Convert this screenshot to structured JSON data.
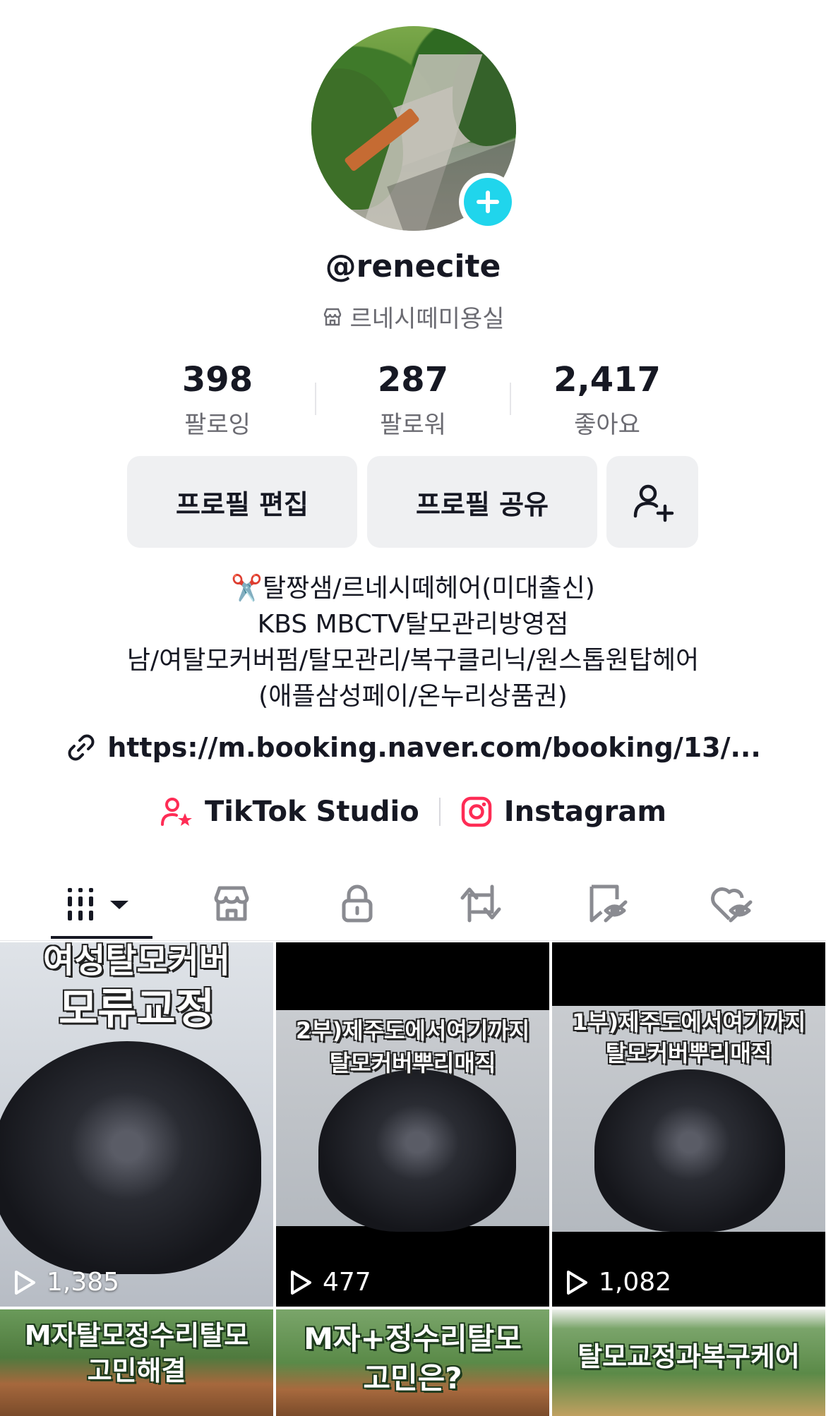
{
  "profile": {
    "username": "@renecite",
    "business_name": "르네시떼미용실",
    "business_icon": "store-icon"
  },
  "stats": [
    {
      "value": "398",
      "label": "팔로잉"
    },
    {
      "value": "287",
      "label": "팔로워"
    },
    {
      "value": "2,417",
      "label": "좋아요"
    }
  ],
  "actions": {
    "edit_profile": "프로필 편집",
    "share_profile": "프로필 공유",
    "add_friend_icon": "add-user-icon"
  },
  "bio": {
    "line1": "✂️탈짱샘/르네시떼헤어(미대출신)",
    "line2": "KBS MBCTV탈모관리방영점",
    "line3": "남/여탈모커버펌/탈모관리/복구클리닉/원스톱원탑헤어",
    "line4": "(애플삼성페이/온누리상품권)"
  },
  "link": {
    "url": "https://m.booking.naver.com/booking/13/..."
  },
  "external_links": {
    "studio": "TikTok Studio",
    "instagram": "Instagram"
  },
  "tabs": [
    {
      "name": "videos",
      "icon": "grid-icon",
      "active": true
    },
    {
      "name": "shop",
      "icon": "shop-icon"
    },
    {
      "name": "private",
      "icon": "lock-icon"
    },
    {
      "name": "reposts",
      "icon": "repost-icon"
    },
    {
      "name": "favorites",
      "icon": "bookmark-hidden-icon"
    },
    {
      "name": "liked",
      "icon": "heart-hidden-icon"
    }
  ],
  "videos": [
    {
      "caption_top": "여성탈모커버",
      "caption": "모류교정",
      "views": "1,385"
    },
    {
      "caption_top": "2부)제주도에서여기까지",
      "caption": "탈모커버뿌리매직",
      "views": "477"
    },
    {
      "caption_top": "1부)제주도에서여기까지",
      "caption": "탈모커버뿌리매직",
      "views": "1,082"
    },
    {
      "caption_top": "M자탈모정수리탈모",
      "caption": "고민해결",
      "views": ""
    },
    {
      "caption_top": "M자+정수리탈모",
      "caption": "고민은?",
      "views": ""
    },
    {
      "caption_top": "탈모교정과복구케어",
      "caption": "",
      "views": ""
    }
  ],
  "colors": {
    "accent": "#20d5ec",
    "tiktok_red": "#fe2c55",
    "text_primary": "#161823",
    "text_secondary": "#6b6b72",
    "button_bg": "#eff0f2"
  }
}
